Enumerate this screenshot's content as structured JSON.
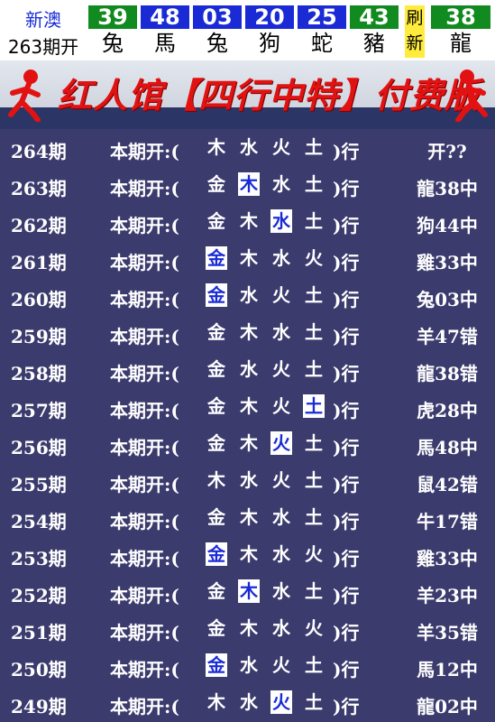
{
  "header": {
    "label_top": "新澳",
    "label_bottom": "263期开",
    "numbers": [
      {
        "num": "39",
        "animal": "兔",
        "color": "#118a1f"
      },
      {
        "num": "48",
        "animal": "馬",
        "color": "#1a2bd6"
      },
      {
        "num": "03",
        "animal": "兔",
        "color": "#1a2bd6"
      },
      {
        "num": "20",
        "animal": "狗",
        "color": "#1a2bd6"
      },
      {
        "num": "25",
        "animal": "蛇",
        "color": "#1a2bd6"
      },
      {
        "num": "43",
        "animal": "豬",
        "color": "#118a1f"
      },
      {
        "num": "38",
        "animal": "龍",
        "color": "#118a1f"
      }
    ],
    "refresh_top": "刷",
    "refresh_bottom": "新"
  },
  "banner": {
    "title": "红人馆【四行中特】付费版"
  },
  "rows": [
    {
      "period": "264期",
      "label": "本期开:(",
      "elements": [
        "木",
        "水",
        "火",
        "土"
      ],
      "hl": -1,
      "close": ")行",
      "result": "开??"
    },
    {
      "period": "263期",
      "label": "本期开:(",
      "elements": [
        "金",
        "木",
        "水",
        "土"
      ],
      "hl": 1,
      "close": ")行",
      "result": "龍38中"
    },
    {
      "period": "262期",
      "label": "本期开:(",
      "elements": [
        "金",
        "木",
        "水",
        "土"
      ],
      "hl": 2,
      "close": ")行",
      "result": "狗44中"
    },
    {
      "period": "261期",
      "label": "本期开:(",
      "elements": [
        "金",
        "木",
        "水",
        "火"
      ],
      "hl": 0,
      "close": ")行",
      "result": "雞33中"
    },
    {
      "period": "260期",
      "label": "本期开:(",
      "elements": [
        "金",
        "水",
        "火",
        "土"
      ],
      "hl": 0,
      "close": ")行",
      "result": "兔03中"
    },
    {
      "period": "259期",
      "label": "本期开:(",
      "elements": [
        "金",
        "木",
        "水",
        "土"
      ],
      "hl": -1,
      "close": ")行",
      "result": "羊47错"
    },
    {
      "period": "258期",
      "label": "本期开:(",
      "elements": [
        "金",
        "水",
        "火",
        "土"
      ],
      "hl": -1,
      "close": ")行",
      "result": "龍38错"
    },
    {
      "period": "257期",
      "label": "本期开:(",
      "elements": [
        "金",
        "木",
        "火",
        "土"
      ],
      "hl": 3,
      "close": ")行",
      "result": "虎28中"
    },
    {
      "period": "256期",
      "label": "本期开:(",
      "elements": [
        "金",
        "木",
        "火",
        "土"
      ],
      "hl": 2,
      "close": ")行",
      "result": "馬48中"
    },
    {
      "period": "255期",
      "label": "本期开:(",
      "elements": [
        "木",
        "水",
        "火",
        "土"
      ],
      "hl": -1,
      "close": ")行",
      "result": "鼠42错"
    },
    {
      "period": "254期",
      "label": "本期开:(",
      "elements": [
        "金",
        "木",
        "水",
        "土"
      ],
      "hl": -1,
      "close": ")行",
      "result": "牛17错"
    },
    {
      "period": "253期",
      "label": "本期开:(",
      "elements": [
        "金",
        "木",
        "水",
        "火"
      ],
      "hl": 0,
      "close": ")行",
      "result": "雞33中"
    },
    {
      "period": "252期",
      "label": "本期开:(",
      "elements": [
        "金",
        "木",
        "水",
        "土"
      ],
      "hl": 1,
      "close": ")行",
      "result": "羊23中"
    },
    {
      "period": "251期",
      "label": "本期开:(",
      "elements": [
        "金",
        "木",
        "水",
        "火"
      ],
      "hl": -1,
      "close": ")行",
      "result": "羊35错"
    },
    {
      "period": "250期",
      "label": "本期开:(",
      "elements": [
        "金",
        "水",
        "火",
        "土"
      ],
      "hl": 0,
      "close": ")行",
      "result": "馬12中"
    },
    {
      "period": "249期",
      "label": "本期开:(",
      "elements": [
        "木",
        "水",
        "火",
        "土"
      ],
      "hl": 2,
      "close": ")行",
      "result": "龍02中"
    }
  ]
}
